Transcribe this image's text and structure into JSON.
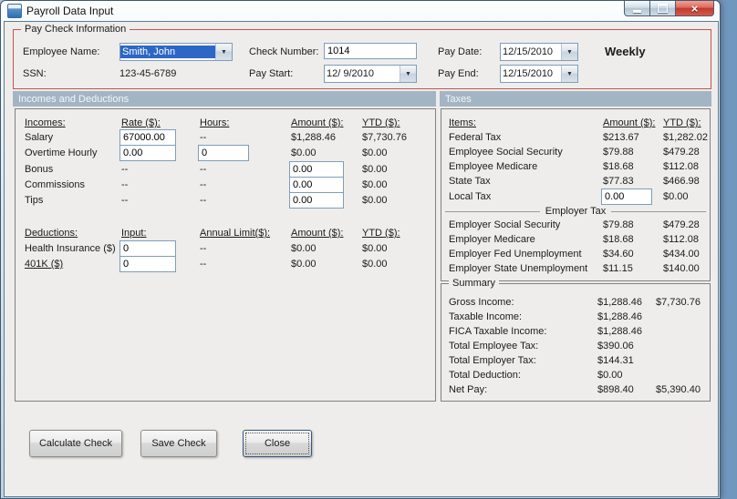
{
  "window": {
    "title": "Payroll Data Input"
  },
  "paycheck_info": {
    "group_label": "Pay Check Information",
    "employee_name_label": "Employee Name:",
    "employee_name_value": "Smith, John",
    "ssn_label": "SSN:",
    "ssn_value": "123-45-6789",
    "check_number_label": "Check Number:",
    "check_number_value": "1014",
    "pay_start_label": "Pay Start:",
    "pay_start_value": "12/ 9/2010",
    "pay_date_label": "Pay Date:",
    "pay_date_value": "12/15/2010",
    "pay_end_label": "Pay End:",
    "pay_end_value": "12/15/2010",
    "frequency": "Weekly"
  },
  "section_headers": {
    "incomes_deductions": "Incomes and Deductions",
    "taxes": "Taxes"
  },
  "incomes": {
    "headers": {
      "name": "Incomes:",
      "rate": "Rate ($):",
      "hours": "Hours:",
      "amount": "Amount ($):",
      "ytd": "YTD ($):"
    },
    "rows": [
      {
        "name": "Salary",
        "rate": "67000.00",
        "hours": "--",
        "amount": "$1,288.46",
        "ytd": "$7,730.76"
      },
      {
        "name": "Overtime Hourly",
        "rate": "0.00",
        "hours": "0",
        "amount": "$0.00",
        "ytd": "$0.00"
      },
      {
        "name": "Bonus",
        "rate": "--",
        "hours": "--",
        "amount": "0.00",
        "ytd": "$0.00"
      },
      {
        "name": "Commissions",
        "rate": "--",
        "hours": "--",
        "amount": "0.00",
        "ytd": "$0.00"
      },
      {
        "name": "Tips",
        "rate": "--",
        "hours": "--",
        "amount": "0.00",
        "ytd": "$0.00"
      }
    ]
  },
  "deductions": {
    "headers": {
      "name": "Deductions:",
      "input": "Input:",
      "annual_limit": "Annual Limit($):",
      "amount": "Amount ($):",
      "ytd": "YTD ($):"
    },
    "rows": [
      {
        "name": "Health Insurance  ($)",
        "input": "0",
        "annual_limit": "--",
        "amount": "$0.00",
        "ytd": "$0.00"
      },
      {
        "name": "401K  ($)",
        "input": "0",
        "annual_limit": "--",
        "amount": "$0.00",
        "ytd": "$0.00"
      }
    ]
  },
  "taxes": {
    "headers": {
      "items": "Items:",
      "amount": "Amount ($):",
      "ytd": "YTD ($):"
    },
    "employee_rows": [
      {
        "name": "Federal Tax",
        "amount": "$213.67",
        "ytd": "$1,282.02"
      },
      {
        "name": "Employee Social Security",
        "amount": "$79.88",
        "ytd": "$479.28"
      },
      {
        "name": "Employee Medicare",
        "amount": "$18.68",
        "ytd": "$112.08"
      },
      {
        "name": "State Tax",
        "amount": "$77.83",
        "ytd": "$466.98"
      },
      {
        "name": "Local Tax",
        "amount": "0.00",
        "ytd": "$0.00"
      }
    ],
    "employer_divider": "Employer Tax",
    "employer_rows": [
      {
        "name": "Employer Social Security",
        "amount": "$79.88",
        "ytd": "$479.28"
      },
      {
        "name": "Employer Medicare",
        "amount": "$18.68",
        "ytd": "$112.08"
      },
      {
        "name": "Employer Fed Unemployment",
        "amount": "$34.60",
        "ytd": "$434.00"
      },
      {
        "name": "Employer State Unemployment",
        "amount": "$11.15",
        "ytd": "$140.00"
      }
    ]
  },
  "summary": {
    "group_label": "Summary",
    "rows": [
      {
        "name": "Gross Income:",
        "amount": "$1,288.46",
        "ytd": "$7,730.76"
      },
      {
        "name": "Taxable Income:",
        "amount": "$1,288.46",
        "ytd": ""
      },
      {
        "name": "FICA Taxable Income:",
        "amount": "$1,288.46",
        "ytd": ""
      },
      {
        "name": "Total Employee Tax:",
        "amount": "$390.06",
        "ytd": ""
      },
      {
        "name": "Total Employer Tax:",
        "amount": "$144.31",
        "ytd": ""
      },
      {
        "name": "Total Deduction:",
        "amount": "$0.00",
        "ytd": ""
      },
      {
        "name": "Net Pay:",
        "amount": "$898.40",
        "ytd": "$5,390.40"
      }
    ]
  },
  "buttons": {
    "calculate": "Calculate Check",
    "save": "Save Check",
    "close": "Close"
  },
  "colors": {
    "section_header_bg": "#a3b5c4",
    "group_border": "#c2544e",
    "selection_bg": "#2e66c6"
  }
}
